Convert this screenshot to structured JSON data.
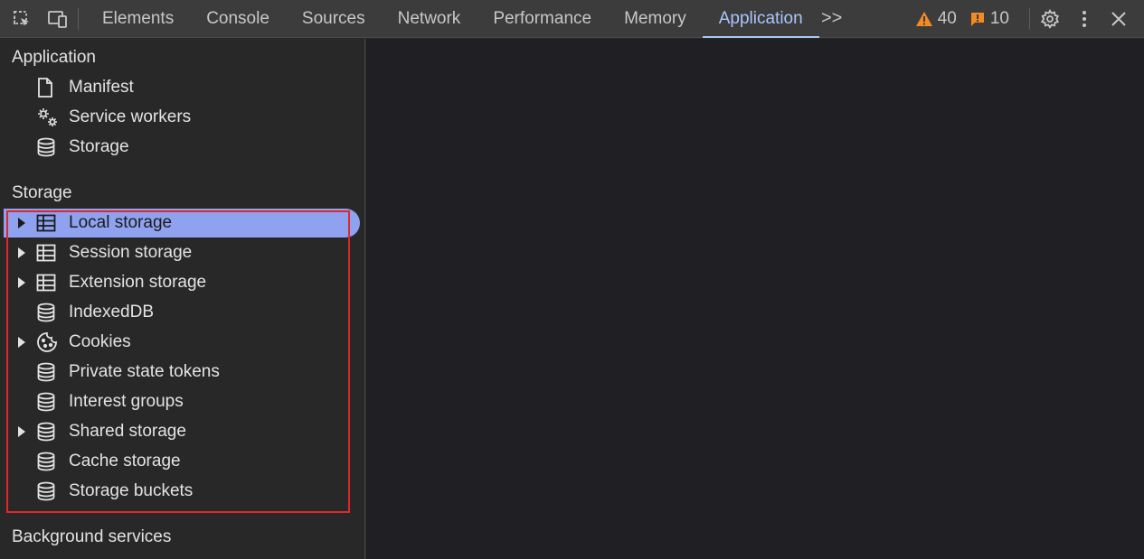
{
  "toolbar": {
    "tabs": [
      {
        "label": "Elements"
      },
      {
        "label": "Console"
      },
      {
        "label": "Sources"
      },
      {
        "label": "Network"
      },
      {
        "label": "Performance"
      },
      {
        "label": "Memory"
      },
      {
        "label": "Application"
      }
    ],
    "more_label": ">>",
    "warnings_count": "40",
    "issues_count": "10",
    "colors": {
      "warning": "#f28b24",
      "issue": "#f28b24",
      "active_tab": "#a8c7fa"
    }
  },
  "sidebar": {
    "application_section": {
      "title": "Application",
      "items": [
        {
          "label": "Manifest",
          "icon": "document-icon"
        },
        {
          "label": "Service workers",
          "icon": "gears-icon"
        },
        {
          "label": "Storage",
          "icon": "database-icon"
        }
      ]
    },
    "storage_section": {
      "title": "Storage",
      "items": [
        {
          "label": "Local storage",
          "icon": "table-icon",
          "expandable": true,
          "selected": true
        },
        {
          "label": "Session storage",
          "icon": "table-icon",
          "expandable": true
        },
        {
          "label": "Extension storage",
          "icon": "table-icon",
          "expandable": true
        },
        {
          "label": "IndexedDB",
          "icon": "database-icon"
        },
        {
          "label": "Cookies",
          "icon": "cookie-icon",
          "expandable": true
        },
        {
          "label": "Private state tokens",
          "icon": "database-icon"
        },
        {
          "label": "Interest groups",
          "icon": "database-icon"
        },
        {
          "label": "Shared storage",
          "icon": "database-icon",
          "expandable": true
        },
        {
          "label": "Cache storage",
          "icon": "database-icon"
        },
        {
          "label": "Storage buckets",
          "icon": "database-icon"
        }
      ]
    },
    "background_section": {
      "title": "Background services"
    },
    "selection_color": "#8ea2f0",
    "highlight_color": "#e0262b"
  }
}
